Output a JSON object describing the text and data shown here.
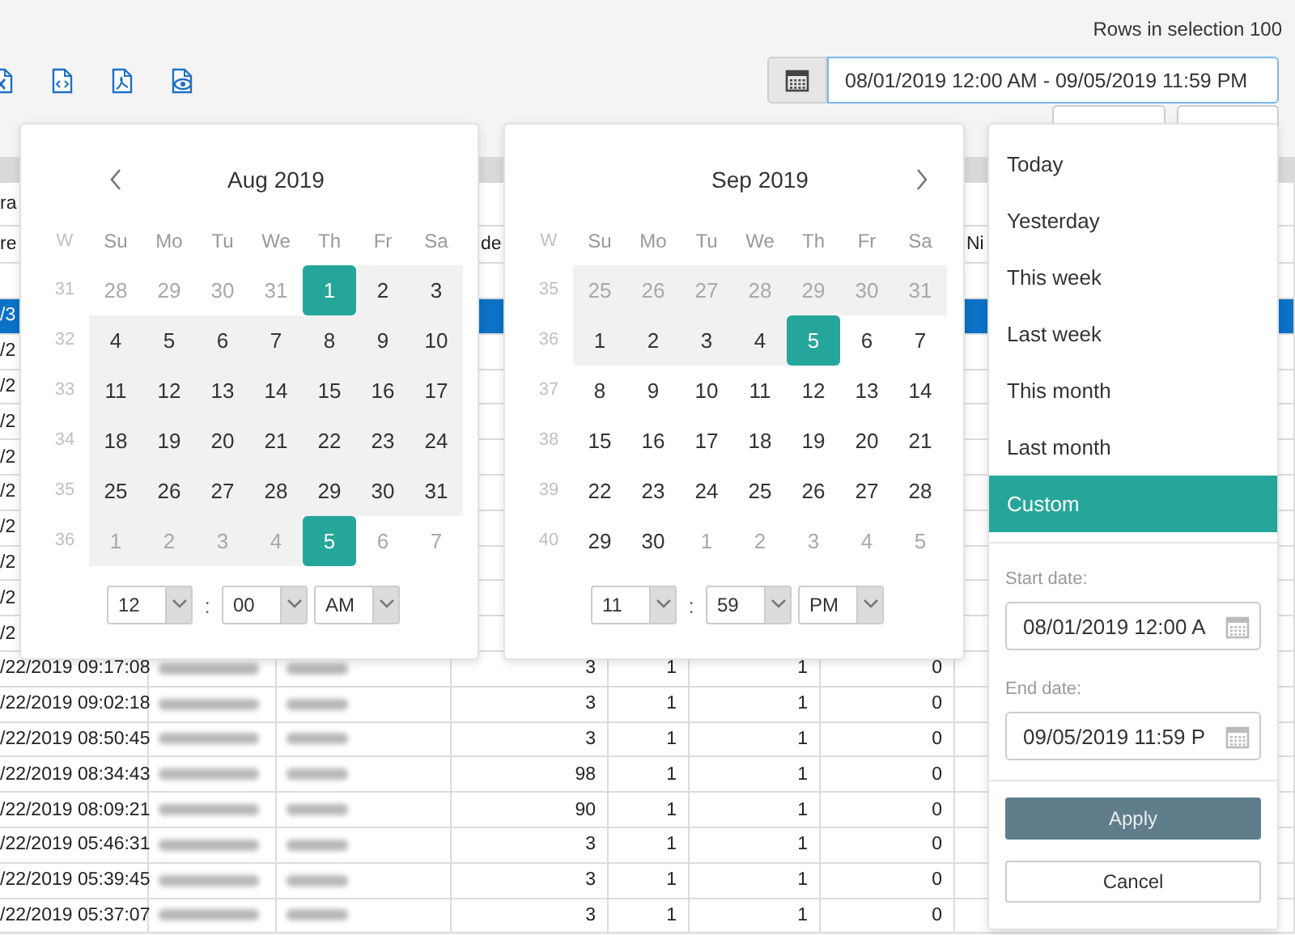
{
  "rows_in_selection": "Rows in selection 100",
  "date_range": {
    "value": "08/01/2019 12:00 AM - 09/05/2019 11:59 PM"
  },
  "table": {
    "header_rows": [
      [
        "ra",
        "",
        "",
        "",
        "",
        "",
        "",
        ""
      ],
      [
        "re",
        "",
        "",
        "de",
        "",
        "",
        "",
        "Ni"
      ]
    ],
    "rows": [
      {
        "time": "/3",
        "selected": true
      },
      {
        "time": "/2",
        "selected": false
      },
      {
        "time": "/2",
        "selected": false
      },
      {
        "time": "/2",
        "selected": false
      },
      {
        "time": "/2",
        "selected": false
      },
      {
        "time": "/2",
        "selected": false
      },
      {
        "time": "/2",
        "selected": false
      },
      {
        "time": "/2",
        "selected": false
      },
      {
        "time": "/2",
        "selected": false
      },
      {
        "time": "/2",
        "selected": false
      },
      {
        "time": "/22/2019 09:17:08",
        "selected": false,
        "blurred": true,
        "values": [
          "3",
          "1",
          "1",
          "0"
        ]
      },
      {
        "time": "/22/2019 09:02:18",
        "selected": false,
        "blurred": true,
        "values": [
          "3",
          "1",
          "1",
          "0"
        ]
      },
      {
        "time": "/22/2019 08:50:45",
        "selected": false,
        "blurred": true,
        "values": [
          "3",
          "1",
          "1",
          "0"
        ]
      },
      {
        "time": "/22/2019 08:34:43",
        "selected": false,
        "blurred": true,
        "values": [
          "98",
          "1",
          "1",
          "0"
        ]
      },
      {
        "time": "/22/2019 08:09:21",
        "selected": false,
        "blurred": true,
        "values": [
          "90",
          "1",
          "1",
          "0"
        ]
      },
      {
        "time": "/22/2019 05:46:31",
        "selected": false,
        "blurred": true,
        "values": [
          "3",
          "1",
          "1",
          "0"
        ]
      },
      {
        "time": "/22/2019 05:39:45",
        "selected": false,
        "blurred": true,
        "values": [
          "3",
          "1",
          "1",
          "0"
        ]
      },
      {
        "time": "/22/2019 05:37:07",
        "selected": false,
        "blurred": true,
        "values": [
          "3",
          "1",
          "1",
          "0"
        ]
      }
    ]
  },
  "calendars": [
    {
      "title": "Aug 2019",
      "has_prev": true,
      "has_next": false,
      "week_label": "W",
      "weekdays": [
        "Su",
        "Mo",
        "Tu",
        "We",
        "Th",
        "Fr",
        "Sa"
      ],
      "weeks": [
        {
          "week": "31",
          "days": [
            {
              "d": "28",
              "outside": true,
              "in_range": false,
              "selected": false
            },
            {
              "d": "29",
              "outside": true,
              "in_range": false,
              "selected": false
            },
            {
              "d": "30",
              "outside": true,
              "in_range": false,
              "selected": false
            },
            {
              "d": "31",
              "outside": true,
              "in_range": false,
              "selected": false
            },
            {
              "d": "1",
              "outside": false,
              "in_range": true,
              "selected": true
            },
            {
              "d": "2",
              "outside": false,
              "in_range": true,
              "selected": false
            },
            {
              "d": "3",
              "outside": false,
              "in_range": true,
              "selected": false
            }
          ]
        },
        {
          "week": "32",
          "days": [
            {
              "d": "4",
              "outside": false,
              "in_range": true,
              "selected": false
            },
            {
              "d": "5",
              "outside": false,
              "in_range": true,
              "selected": false
            },
            {
              "d": "6",
              "outside": false,
              "in_range": true,
              "selected": false
            },
            {
              "d": "7",
              "outside": false,
              "in_range": true,
              "selected": false
            },
            {
              "d": "8",
              "outside": false,
              "in_range": true,
              "selected": false
            },
            {
              "d": "9",
              "outside": false,
              "in_range": true,
              "selected": false
            },
            {
              "d": "10",
              "outside": false,
              "in_range": true,
              "selected": false
            }
          ]
        },
        {
          "week": "33",
          "days": [
            {
              "d": "11",
              "outside": false,
              "in_range": true,
              "selected": false
            },
            {
              "d": "12",
              "outside": false,
              "in_range": true,
              "selected": false
            },
            {
              "d": "13",
              "outside": false,
              "in_range": true,
              "selected": false
            },
            {
              "d": "14",
              "outside": false,
              "in_range": true,
              "selected": false
            },
            {
              "d": "15",
              "outside": false,
              "in_range": true,
              "selected": false
            },
            {
              "d": "16",
              "outside": false,
              "in_range": true,
              "selected": false
            },
            {
              "d": "17",
              "outside": false,
              "in_range": true,
              "selected": false
            }
          ]
        },
        {
          "week": "34",
          "days": [
            {
              "d": "18",
              "outside": false,
              "in_range": true,
              "selected": false
            },
            {
              "d": "19",
              "outside": false,
              "in_range": true,
              "selected": false
            },
            {
              "d": "20",
              "outside": false,
              "in_range": true,
              "selected": false
            },
            {
              "d": "21",
              "outside": false,
              "in_range": true,
              "selected": false
            },
            {
              "d": "22",
              "outside": false,
              "in_range": true,
              "selected": false
            },
            {
              "d": "23",
              "outside": false,
              "in_range": true,
              "selected": false
            },
            {
              "d": "24",
              "outside": false,
              "in_range": true,
              "selected": false
            }
          ]
        },
        {
          "week": "35",
          "days": [
            {
              "d": "25",
              "outside": false,
              "in_range": true,
              "selected": false
            },
            {
              "d": "26",
              "outside": false,
              "in_range": true,
              "selected": false
            },
            {
              "d": "27",
              "outside": false,
              "in_range": true,
              "selected": false
            },
            {
              "d": "28",
              "outside": false,
              "in_range": true,
              "selected": false
            },
            {
              "d": "29",
              "outside": false,
              "in_range": true,
              "selected": false
            },
            {
              "d": "30",
              "outside": false,
              "in_range": true,
              "selected": false
            },
            {
              "d": "31",
              "outside": false,
              "in_range": true,
              "selected": false
            }
          ]
        },
        {
          "week": "36",
          "days": [
            {
              "d": "1",
              "outside": true,
              "in_range": true,
              "selected": false
            },
            {
              "d": "2",
              "outside": true,
              "in_range": true,
              "selected": false
            },
            {
              "d": "3",
              "outside": true,
              "in_range": true,
              "selected": false
            },
            {
              "d": "4",
              "outside": true,
              "in_range": true,
              "selected": false
            },
            {
              "d": "5",
              "outside": true,
              "in_range": true,
              "selected": true
            },
            {
              "d": "6",
              "outside": true,
              "in_range": false,
              "selected": false
            },
            {
              "d": "7",
              "outside": true,
              "in_range": false,
              "selected": false
            }
          ]
        }
      ],
      "time": {
        "hour": "12",
        "separator": ":",
        "minute": "00",
        "period": "AM"
      }
    },
    {
      "title": "Sep 2019",
      "has_prev": false,
      "has_next": true,
      "week_label": "W",
      "weekdays": [
        "Su",
        "Mo",
        "Tu",
        "We",
        "Th",
        "Fr",
        "Sa"
      ],
      "weeks": [
        {
          "week": "35",
          "days": [
            {
              "d": "25",
              "outside": true,
              "in_range": true,
              "selected": false
            },
            {
              "d": "26",
              "outside": true,
              "in_range": true,
              "selected": false
            },
            {
              "d": "27",
              "outside": true,
              "in_range": true,
              "selected": false
            },
            {
              "d": "28",
              "outside": true,
              "in_range": true,
              "selected": false
            },
            {
              "d": "29",
              "outside": true,
              "in_range": true,
              "selected": false
            },
            {
              "d": "30",
              "outside": true,
              "in_range": true,
              "selected": false
            },
            {
              "d": "31",
              "outside": true,
              "in_range": true,
              "selected": false
            }
          ]
        },
        {
          "week": "36",
          "days": [
            {
              "d": "1",
              "outside": false,
              "in_range": true,
              "selected": false
            },
            {
              "d": "2",
              "outside": false,
              "in_range": true,
              "selected": false
            },
            {
              "d": "3",
              "outside": false,
              "in_range": true,
              "selected": false
            },
            {
              "d": "4",
              "outside": false,
              "in_range": true,
              "selected": false
            },
            {
              "d": "5",
              "outside": false,
              "in_range": true,
              "selected": true
            },
            {
              "d": "6",
              "outside": false,
              "in_range": false,
              "selected": false
            },
            {
              "d": "7",
              "outside": false,
              "in_range": false,
              "selected": false
            }
          ]
        },
        {
          "week": "37",
          "days": [
            {
              "d": "8",
              "outside": false,
              "in_range": false,
              "selected": false
            },
            {
              "d": "9",
              "outside": false,
              "in_range": false,
              "selected": false
            },
            {
              "d": "10",
              "outside": false,
              "in_range": false,
              "selected": false
            },
            {
              "d": "11",
              "outside": false,
              "in_range": false,
              "selected": false
            },
            {
              "d": "12",
              "outside": false,
              "in_range": false,
              "selected": false
            },
            {
              "d": "13",
              "outside": false,
              "in_range": false,
              "selected": false
            },
            {
              "d": "14",
              "outside": false,
              "in_range": false,
              "selected": false
            }
          ]
        },
        {
          "week": "38",
          "days": [
            {
              "d": "15",
              "outside": false,
              "in_range": false,
              "selected": false
            },
            {
              "d": "16",
              "outside": false,
              "in_range": false,
              "selected": false
            },
            {
              "d": "17",
              "outside": false,
              "in_range": false,
              "selected": false
            },
            {
              "d": "18",
              "outside": false,
              "in_range": false,
              "selected": false
            },
            {
              "d": "19",
              "outside": false,
              "in_range": false,
              "selected": false
            },
            {
              "d": "20",
              "outside": false,
              "in_range": false,
              "selected": false
            },
            {
              "d": "21",
              "outside": false,
              "in_range": false,
              "selected": false
            }
          ]
        },
        {
          "week": "39",
          "days": [
            {
              "d": "22",
              "outside": false,
              "in_range": false,
              "selected": false
            },
            {
              "d": "23",
              "outside": false,
              "in_range": false,
              "selected": false
            },
            {
              "d": "24",
              "outside": false,
              "in_range": false,
              "selected": false
            },
            {
              "d": "25",
              "outside": false,
              "in_range": false,
              "selected": false
            },
            {
              "d": "26",
              "outside": false,
              "in_range": false,
              "selected": false
            },
            {
              "d": "27",
              "outside": false,
              "in_range": false,
              "selected": false
            },
            {
              "d": "28",
              "outside": false,
              "in_range": false,
              "selected": false
            }
          ]
        },
        {
          "week": "40",
          "days": [
            {
              "d": "29",
              "outside": false,
              "in_range": false,
              "selected": false
            },
            {
              "d": "30",
              "outside": false,
              "in_range": false,
              "selected": false
            },
            {
              "d": "1",
              "outside": true,
              "in_range": false,
              "selected": false
            },
            {
              "d": "2",
              "outside": true,
              "in_range": false,
              "selected": false
            },
            {
              "d": "3",
              "outside": true,
              "in_range": false,
              "selected": false
            },
            {
              "d": "4",
              "outside": true,
              "in_range": false,
              "selected": false
            },
            {
              "d": "5",
              "outside": true,
              "in_range": false,
              "selected": false
            }
          ]
        }
      ],
      "time": {
        "hour": "11",
        "separator": ":",
        "minute": "59",
        "period": "PM"
      }
    }
  ],
  "ranges": {
    "options": [
      {
        "label": "Today",
        "selected": false
      },
      {
        "label": "Yesterday",
        "selected": false
      },
      {
        "label": "This week",
        "selected": false
      },
      {
        "label": "Last week",
        "selected": false
      },
      {
        "label": "This month",
        "selected": false
      },
      {
        "label": "Last month",
        "selected": false
      },
      {
        "label": "Custom",
        "selected": true
      }
    ],
    "start_label": "Start date:",
    "start_value": "08/01/2019 12:00 A",
    "end_label": "End date:",
    "end_value": "09/05/2019 11:59 P",
    "apply": "Apply",
    "cancel": "Cancel"
  }
}
